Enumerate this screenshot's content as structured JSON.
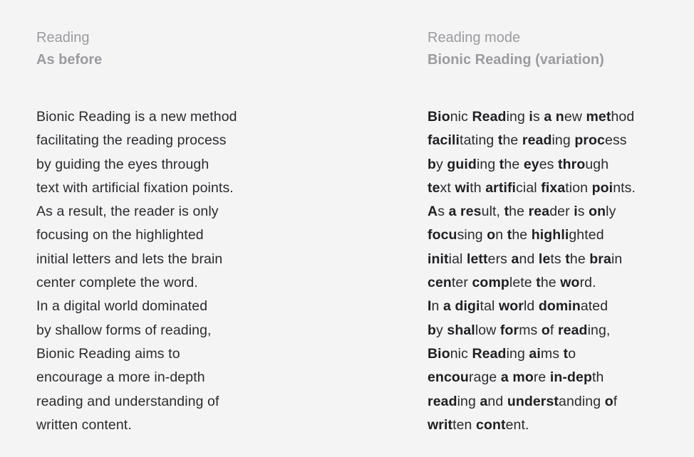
{
  "left": {
    "label": "Reading",
    "title": "As before",
    "lines": [
      "Bionic Reading is a new method",
      "facilitating the reading process",
      "by guiding the eyes through",
      "text with artificial fixation points.",
      "As a result, the reader is only",
      "focusing on the highlighted",
      "initial letters and lets the brain",
      "center complete the word.",
      "In a digital world dominated",
      "by shallow forms of reading,",
      "Bionic Reading aims to",
      "encourage a more in-depth",
      "reading and understanding of",
      "written content."
    ]
  },
  "right": {
    "label": "Reading mode",
    "title": "Bionic Reading (variation)",
    "lines": [
      [
        [
          "Bio",
          "nic",
          " "
        ],
        [
          "Read",
          "ing",
          " "
        ],
        [
          "i",
          "s",
          " "
        ],
        [
          "a",
          "",
          " "
        ],
        [
          "n",
          "ew",
          " "
        ],
        [
          "met",
          "hod",
          ""
        ]
      ],
      [
        [
          "facili",
          "tating",
          " "
        ],
        [
          "t",
          "he",
          " "
        ],
        [
          "read",
          "ing",
          " "
        ],
        [
          "proc",
          "ess",
          ""
        ]
      ],
      [
        [
          "b",
          "y",
          " "
        ],
        [
          "guid",
          "ing",
          " "
        ],
        [
          "t",
          "he",
          " "
        ],
        [
          "ey",
          "es",
          " "
        ],
        [
          "thro",
          "ugh",
          ""
        ]
      ],
      [
        [
          "te",
          "xt",
          " "
        ],
        [
          "wi",
          "th",
          " "
        ],
        [
          "artifi",
          "cial",
          " "
        ],
        [
          "fixa",
          "tion",
          " "
        ],
        [
          "poi",
          "nts.",
          ""
        ]
      ],
      [
        [
          "A",
          "s",
          " "
        ],
        [
          "a",
          "",
          " "
        ],
        [
          "res",
          "ult,",
          " "
        ],
        [
          "t",
          "he",
          " "
        ],
        [
          "rea",
          "der",
          " "
        ],
        [
          "i",
          "s",
          " "
        ],
        [
          "on",
          "ly",
          ""
        ]
      ],
      [
        [
          "focu",
          "sing",
          " "
        ],
        [
          "o",
          "n",
          " "
        ],
        [
          "t",
          "he",
          " "
        ],
        [
          "highli",
          "ghted",
          ""
        ]
      ],
      [
        [
          "init",
          "ial",
          " "
        ],
        [
          "lett",
          "ers",
          " "
        ],
        [
          "a",
          "nd",
          " "
        ],
        [
          "le",
          "ts",
          " "
        ],
        [
          "t",
          "he",
          " "
        ],
        [
          "bra",
          "in",
          ""
        ]
      ],
      [
        [
          "cen",
          "ter",
          " "
        ],
        [
          "comp",
          "lete",
          " "
        ],
        [
          "t",
          "he",
          " "
        ],
        [
          "wo",
          "rd.",
          ""
        ]
      ],
      [
        [
          "I",
          "n",
          " "
        ],
        [
          "a",
          "",
          " "
        ],
        [
          "digi",
          "tal",
          " "
        ],
        [
          "wor",
          "ld",
          " "
        ],
        [
          "domin",
          "ated",
          ""
        ]
      ],
      [
        [
          "b",
          "y",
          " "
        ],
        [
          "shal",
          "low",
          " "
        ],
        [
          "for",
          "ms",
          " "
        ],
        [
          "o",
          "f",
          " "
        ],
        [
          "read",
          "ing,",
          ""
        ]
      ],
      [
        [
          "Bio",
          "nic",
          " "
        ],
        [
          "Read",
          "ing",
          " "
        ],
        [
          "ai",
          "ms",
          " "
        ],
        [
          "t",
          "o",
          ""
        ]
      ],
      [
        [
          "encou",
          "rage",
          " "
        ],
        [
          "a",
          "",
          " "
        ],
        [
          "mo",
          "re",
          " "
        ],
        [
          "in-dep",
          "th",
          ""
        ]
      ],
      [
        [
          "read",
          "ing",
          " "
        ],
        [
          "a",
          "nd",
          " "
        ],
        [
          "underst",
          "anding",
          " "
        ],
        [
          "o",
          "f",
          ""
        ]
      ],
      [
        [
          "writ",
          "ten",
          " "
        ],
        [
          "cont",
          "ent.",
          ""
        ]
      ]
    ]
  }
}
